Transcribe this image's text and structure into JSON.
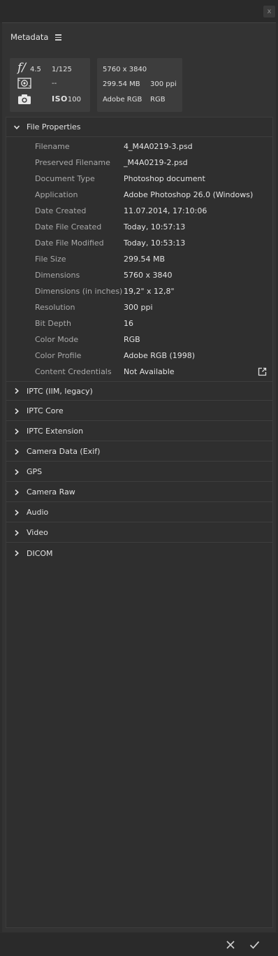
{
  "window": {
    "close_glyph": "x"
  },
  "panel": {
    "title": "Metadata",
    "menu_icon": "hamburger-menu-icon"
  },
  "summary": {
    "f_symbol": "f/",
    "aperture": "4.5",
    "shutter": "1/125",
    "metering": "--",
    "iso_label": "ISO",
    "iso_value": "100",
    "dimensions": "5760 x 3840",
    "file_size": "299.54 MB",
    "resolution": "300 ppi",
    "color_profile": "Adobe RGB",
    "color_mode": "RGB"
  },
  "file_properties": {
    "label": "File Properties",
    "rows": [
      {
        "key": "Filename",
        "value": "4_M4A0219-3.psd"
      },
      {
        "key": "Preserved Filename",
        "value": "_M4A0219-2.psd"
      },
      {
        "key": "Document Type",
        "value": "Photoshop document"
      },
      {
        "key": "Application",
        "value": "Adobe Photoshop 26.0 (Windows)"
      },
      {
        "key": "Date Created",
        "value": "11.07.2014, 17:10:06"
      },
      {
        "key": "Date File Created",
        "value": "Today, 10:57:13"
      },
      {
        "key": "Date File Modified",
        "value": "Today, 10:53:13"
      },
      {
        "key": "File Size",
        "value": "299.54 MB"
      },
      {
        "key": "Dimensions",
        "value": "5760 x 3840"
      },
      {
        "key": "Dimensions (in inches)",
        "value": "19,2\" x 12,8\""
      },
      {
        "key": "Resolution",
        "value": "300 ppi"
      },
      {
        "key": "Bit Depth",
        "value": "16"
      },
      {
        "key": "Color Mode",
        "value": "RGB"
      },
      {
        "key": "Color Profile",
        "value": "Adobe RGB (1998)"
      },
      {
        "key": "Content Credentials",
        "value": "Not Available"
      }
    ]
  },
  "sections": [
    {
      "label": "IPTC (IIM, legacy)"
    },
    {
      "label": "IPTC Core"
    },
    {
      "label": "IPTC Extension"
    },
    {
      "label": "Camera Data (Exif)"
    },
    {
      "label": "GPS"
    },
    {
      "label": "Camera Raw"
    },
    {
      "label": "Audio"
    },
    {
      "label": "Video"
    },
    {
      "label": "DICOM"
    }
  ],
  "colors": {
    "panel_bg": "#333333",
    "summary_bg": "#3d3d3d",
    "label_text": "#a9a9a9",
    "value_text": "#e4e4e4"
  }
}
